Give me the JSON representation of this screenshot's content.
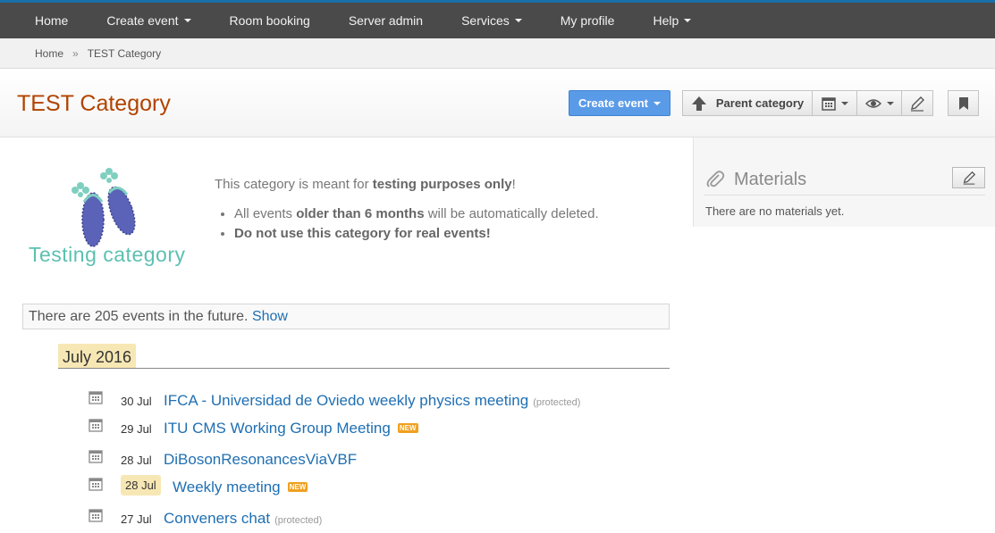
{
  "nav": {
    "items": [
      {
        "label": "Home",
        "dropdown": false
      },
      {
        "label": "Create event",
        "dropdown": true
      },
      {
        "label": "Room booking",
        "dropdown": false
      },
      {
        "label": "Server admin",
        "dropdown": false
      },
      {
        "label": "Services",
        "dropdown": true
      },
      {
        "label": "My profile",
        "dropdown": false
      },
      {
        "label": "Help",
        "dropdown": true
      }
    ]
  },
  "breadcrumb": {
    "home": "Home",
    "separator": "»",
    "current": "TEST Category"
  },
  "header": {
    "title": "TEST Category",
    "create_event_label": "Create event",
    "parent_category_label": "Parent category"
  },
  "description": {
    "intro_pre": "This category is meant for ",
    "intro_bold": "testing purposes only",
    "intro_post": "!",
    "bullet1_pre": "All events ",
    "bullet1_bold": "older than 6 months",
    "bullet1_post": " will be automatically deleted.",
    "bullet2_bold": "Do not use this category for real events!"
  },
  "logo": {
    "caption": "Testing category"
  },
  "materials": {
    "title": "Materials",
    "empty_text": "There are no materials yet."
  },
  "future": {
    "text": "There are 205 events in the future. ",
    "link": "Show"
  },
  "month": "July 2016",
  "events": [
    {
      "date": "30 Jul",
      "title": "IFCA - Universidad de Oviedo weekly physics meeting",
      "protected": "(protected)",
      "new": ""
    },
    {
      "date": "29 Jul",
      "title": "ITU CMS Working Group Meeting",
      "protected": "",
      "new": "NEW"
    },
    {
      "date": "28 Jul",
      "title": "DiBosonResonancesViaVBF",
      "protected": "",
      "new": ""
    },
    {
      "date": "28 Jul",
      "title": "Weekly meeting",
      "protected": "",
      "new": "NEW"
    },
    {
      "date": "27 Jul",
      "title": "Conveners chat",
      "protected": "(protected)",
      "new": ""
    }
  ],
  "colors": {
    "accent": "#b14300",
    "link": "#1f6fb2",
    "highlight": "#f7e7b4",
    "nav_bg": "#4a4a4a",
    "primary_button": "#5a9be8"
  }
}
